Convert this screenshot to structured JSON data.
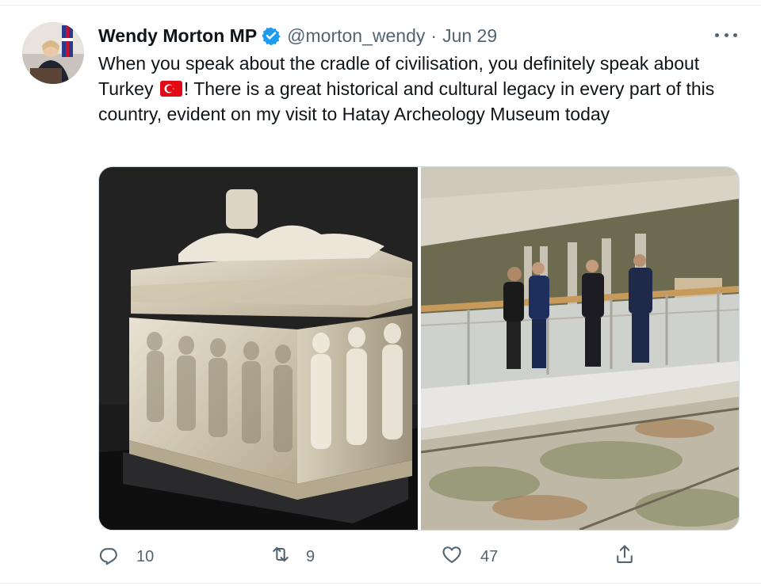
{
  "tweet": {
    "author_name": "Wendy Morton MP",
    "handle": "@morton_wendy",
    "separator": "·",
    "date": "Jun 29",
    "text_before_flag": "When you speak about the cradle of civilisation, you definitely speak about Turkey ",
    "text_after_flag": "! There is a great historical and cultural legacy in every part of this  country, evident on my visit to Hatay Archeology Museum today"
  },
  "actions": {
    "reply_count": "10",
    "retweet_count": "9",
    "like_count": "47"
  },
  "icons": {
    "verified": "verified-badge-icon",
    "more": "more-options-icon",
    "reply": "reply-icon",
    "retweet": "retweet-icon",
    "like": "heart-icon",
    "share": "share-icon",
    "flag": "turkey-flag-emoji"
  },
  "colors": {
    "text_primary": "#0f1419",
    "text_secondary": "#536471",
    "verified_blue": "#1d9bf0",
    "flag_red": "#e30a17"
  }
}
